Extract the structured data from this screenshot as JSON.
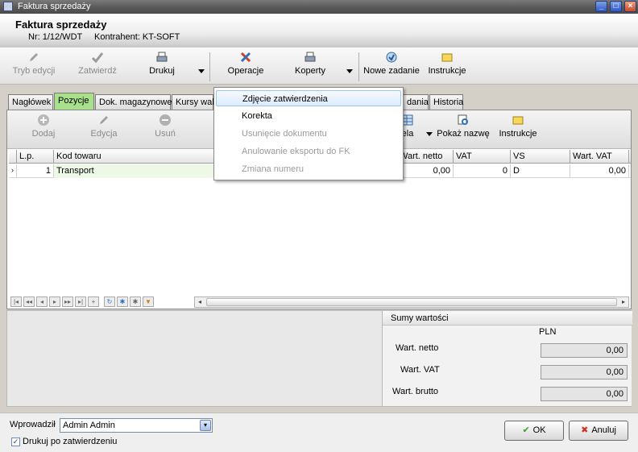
{
  "window": {
    "title": "Faktura sprzedaży"
  },
  "header": {
    "doc_title": "Faktura sprzedaży",
    "nr": "Nr: 1/12/WDT",
    "kontrahent": "Kontrahent: KT-SOFT"
  },
  "toolbar": {
    "tryb_edycji": "Tryb edycji",
    "zatwierdz": "Zatwierdź",
    "drukuj": "Drukuj",
    "operacje": "Operacje",
    "koperty": "Koperty",
    "nowe_zadanie": "Nowe zadanie",
    "instrukcje": "Instrukcje"
  },
  "tabs": [
    "Nagłówek",
    "Pozycje",
    "Dok. magazynowe",
    "Kursy walu",
    "dania",
    "Historia"
  ],
  "inner_toolbar": {
    "dodaj": "Dodaj",
    "edycja": "Edycja",
    "usun": "Usuń",
    "tabela": "ela",
    "pokaz_nazwe": "Pokaż nazwę",
    "instrukcje": "Instrukcje"
  },
  "grid": {
    "columns": [
      "L.p.",
      "Kod towaru",
      "Wart. netto",
      "VAT",
      "VS",
      "Wart. VAT"
    ],
    "rows": [
      {
        "lp": "1",
        "kod": "Transport",
        "netto": "0,00",
        "vat": "0",
        "vs": "D",
        "wart_vat": "0,00"
      }
    ]
  },
  "sumy": {
    "caption": "Sumy wartości",
    "currency": "PLN",
    "netto_label": "Wart. netto",
    "netto": "0,00",
    "vat_label": "Wart. VAT",
    "vat": "0,00",
    "brutto_label": "Wart. brutto",
    "brutto": "0,00"
  },
  "footer": {
    "wprowadzil_label": "Wprowadził",
    "wprowadzil_value": "Admin Admin",
    "drukuj_chk": "Drukuj po zatwierdzeniu",
    "ok": "OK",
    "anuluj": "Anuluj"
  },
  "menu": {
    "items": [
      "Zdjęcie zatwierdzenia",
      "Korekta",
      "Usunięcie dokumentu",
      "Anulowanie eksportu do FK",
      "Zmiana numeru"
    ]
  }
}
